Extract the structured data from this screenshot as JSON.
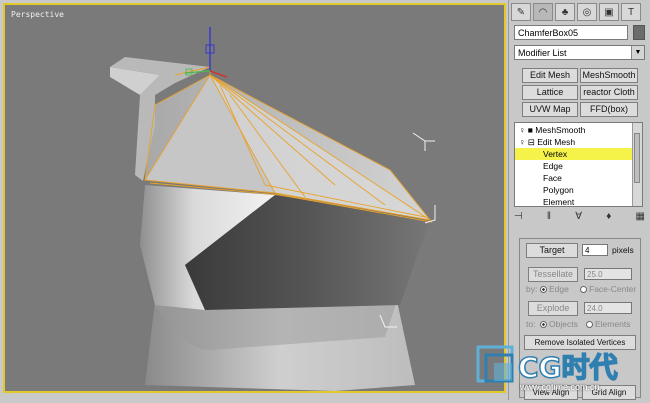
{
  "viewport": {
    "label": "Perspective"
  },
  "panel": {
    "tabs": [
      {
        "icon": "create-icon",
        "glyph": "✎"
      },
      {
        "icon": "modify-icon",
        "glyph": "◠"
      },
      {
        "icon": "hierarchy-icon",
        "glyph": "♣"
      },
      {
        "icon": "motion-icon",
        "glyph": "◎"
      },
      {
        "icon": "display-icon",
        "glyph": "▣"
      },
      {
        "icon": "utilities-icon",
        "glyph": "T"
      }
    ],
    "object_name": "ChamferBox05",
    "modifier_list": "Modifier List",
    "modifier_buttons": [
      "Edit Mesh",
      "MeshSmooth",
      "Lattice",
      "reactor Cloth",
      "UVW Map",
      "FFD(box)"
    ],
    "stack": [
      {
        "label": "MeshSmooth",
        "level": 0,
        "selected": false
      },
      {
        "label": "Edit Mesh",
        "level": 0,
        "selected": false
      },
      {
        "label": "Vertex",
        "level": 1,
        "selected": true
      },
      {
        "label": "Edge",
        "level": 1,
        "selected": false
      },
      {
        "label": "Face",
        "level": 1,
        "selected": false
      },
      {
        "label": "Polygon",
        "level": 1,
        "selected": false
      },
      {
        "label": "Element",
        "level": 1,
        "selected": false
      }
    ],
    "target": {
      "button": "Target",
      "value": "4",
      "unit": "pixels"
    },
    "tessellate": {
      "button": "Tessellate",
      "value": "25.0",
      "by": "by:",
      "opt1": "Edge",
      "opt2": "Face-Center"
    },
    "explode": {
      "button": "Explode",
      "value": "24.0",
      "to": "to:",
      "opt1": "Objects",
      "opt2": "Elements"
    },
    "remove_isolated": "Remove Isolated Vertices",
    "view_align": "View Align",
    "grid_align": "Grid Align"
  },
  "watermark": {
    "brand": "CG时代",
    "url": "www.cgtime.com.cn"
  }
}
